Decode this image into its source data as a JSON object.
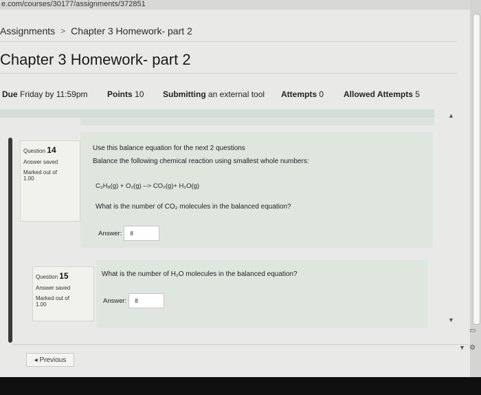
{
  "browser": {
    "url_fragment": "e.com/courses/30177/assignments/372851"
  },
  "breadcrumb": {
    "parent": "Assignments",
    "separator": ">",
    "current": "Chapter 3 Homework- part 2"
  },
  "page": {
    "title": "Chapter 3 Homework- part 2"
  },
  "details": {
    "due_label": "Due",
    "due_value": "Friday by 11:59pm",
    "points_label": "Points",
    "points_value": "10",
    "submitting_label": "Submitting",
    "submitting_value": "an external tool",
    "attempts_label": "Attempts",
    "attempts_value": "0",
    "allowed_label": "Allowed Attempts",
    "allowed_value": "5"
  },
  "questions": [
    {
      "label": "Question",
      "number": "14",
      "status": "Answer saved",
      "marked_label": "Marked out of",
      "marked_value": "1.00",
      "intro": "Use this balance equation for the next 2 questions",
      "instruction": "Balance the following chemical reaction using smallest whole numbers:",
      "equation": "C₃H₈(g) + O₂(g) --> CO₂(g)+ H₂O(g)",
      "prompt": "What is the number of CO₂ molecules in the balanced equation?",
      "answer_label": "Answer:",
      "answer_value": "8"
    },
    {
      "label": "Question",
      "number": "15",
      "status": "Answer saved",
      "marked_label": "Marked out of",
      "marked_value": "1.00",
      "prompt": "What is the number of H₂O molecules in the balanced equation?",
      "answer_label": "Answer:",
      "answer_value": "8"
    }
  ],
  "navigation": {
    "previous": "◂ Previous"
  }
}
